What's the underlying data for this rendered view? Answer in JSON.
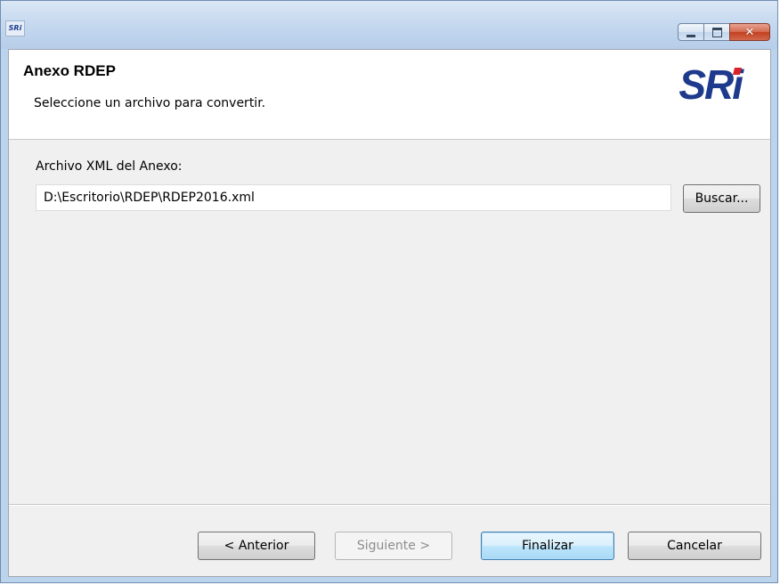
{
  "window": {
    "icon_text": "SRi"
  },
  "header": {
    "title": "Anexo RDEP",
    "description": "Seleccione un archivo para convertir.",
    "logo": "SRi"
  },
  "form": {
    "field_label": "Archivo XML del Anexo:",
    "path_value": "D:\\Escritorio\\RDEP\\RDEP2016.xml",
    "browse_label": "Buscar..."
  },
  "footer": {
    "back_label": "< Anterior",
    "next_label": "Siguiente >",
    "finish_label": "Finalizar",
    "cancel_label": "Cancelar"
  },
  "icons": {
    "minimize": "minimize-icon",
    "maximize": "maximize-icon",
    "close": "close-icon"
  },
  "colors": {
    "logo_blue": "#1e3a8c",
    "logo_accent_red": "#d9232a",
    "default_button_border": "#3c7fb1"
  }
}
